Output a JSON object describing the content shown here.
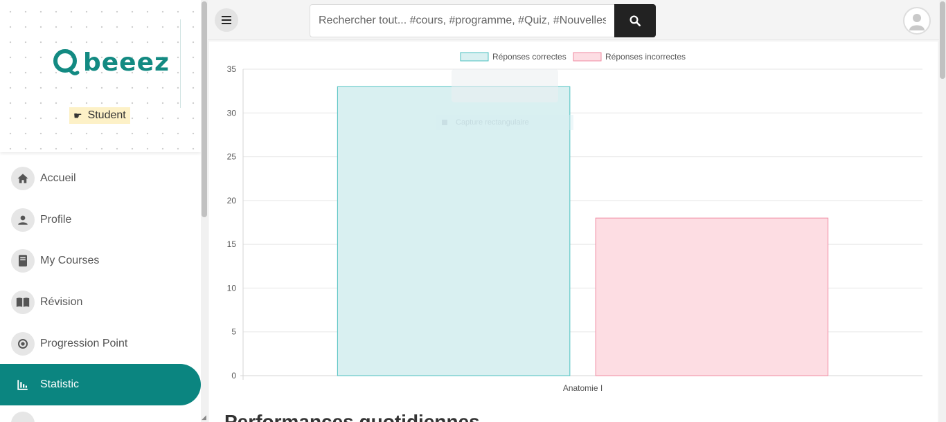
{
  "brand": {
    "logo_text": "beeez",
    "role": "Student"
  },
  "nav": {
    "items": [
      {
        "label": "Accueil",
        "icon": "home-icon"
      },
      {
        "label": "Profile",
        "icon": "user-icon"
      },
      {
        "label": "My Courses",
        "icon": "book-icon"
      },
      {
        "label": "Révision",
        "icon": "open-book-icon"
      },
      {
        "label": "Progression Point",
        "icon": "target-icon"
      },
      {
        "label": "Statistic",
        "icon": "bar-chart-icon",
        "active": true
      }
    ]
  },
  "search": {
    "placeholder": "Rechercher tout... #cours, #programme, #Quiz, #Nouvelles"
  },
  "overlay": {
    "tip": "Capture rectangulaire"
  },
  "section": {
    "title": "Performances quotidiennes"
  },
  "colors": {
    "accent": "#0b8580",
    "correct_fill": "#d9f0f1",
    "correct_border": "#4cc0c0",
    "incorrect_fill": "#fddde3",
    "incorrect_border": "#f08aa2"
  },
  "chart_data": {
    "type": "bar",
    "categories": [
      "Anatomie I"
    ],
    "series": [
      {
        "name": "Réponses correctes",
        "values": [
          33
        ]
      },
      {
        "name": "Réponses incorrectes",
        "values": [
          18
        ]
      }
    ],
    "ylim": [
      0,
      35
    ],
    "yticks": [
      0,
      5,
      10,
      15,
      20,
      25,
      30,
      35
    ],
    "grid": true,
    "legend": "top-center"
  }
}
